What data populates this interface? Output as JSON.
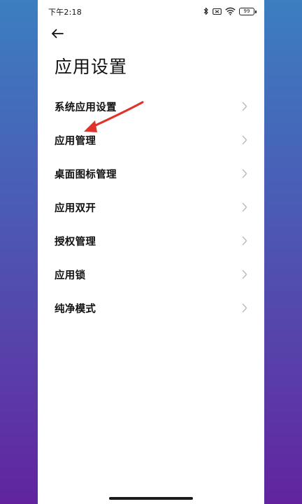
{
  "status_bar": {
    "time": "下午2:18",
    "battery_level": "99",
    "icons": [
      "bluetooth-icon",
      "battery-saver-icon",
      "wifi-icon",
      "battery-icon"
    ]
  },
  "header": {
    "back_icon": "arrow-left-icon",
    "title": "应用设置"
  },
  "menu": {
    "items": [
      {
        "label": "系统应用设置"
      },
      {
        "label": "应用管理"
      },
      {
        "label": "桌面图标管理"
      },
      {
        "label": "应用双开"
      },
      {
        "label": "授权管理"
      },
      {
        "label": "应用锁"
      },
      {
        "label": "纯净模式"
      }
    ],
    "chevron_icon": "chevron-right-icon"
  },
  "annotation": {
    "type": "arrow",
    "color": "#e0322b",
    "points_to": "应用管理"
  },
  "colors": {
    "background_top": "#3c7ec0",
    "background_bottom": "#61249e",
    "panel": "#ffffff",
    "text": "#111111",
    "chevron": "#b8b8b8"
  }
}
